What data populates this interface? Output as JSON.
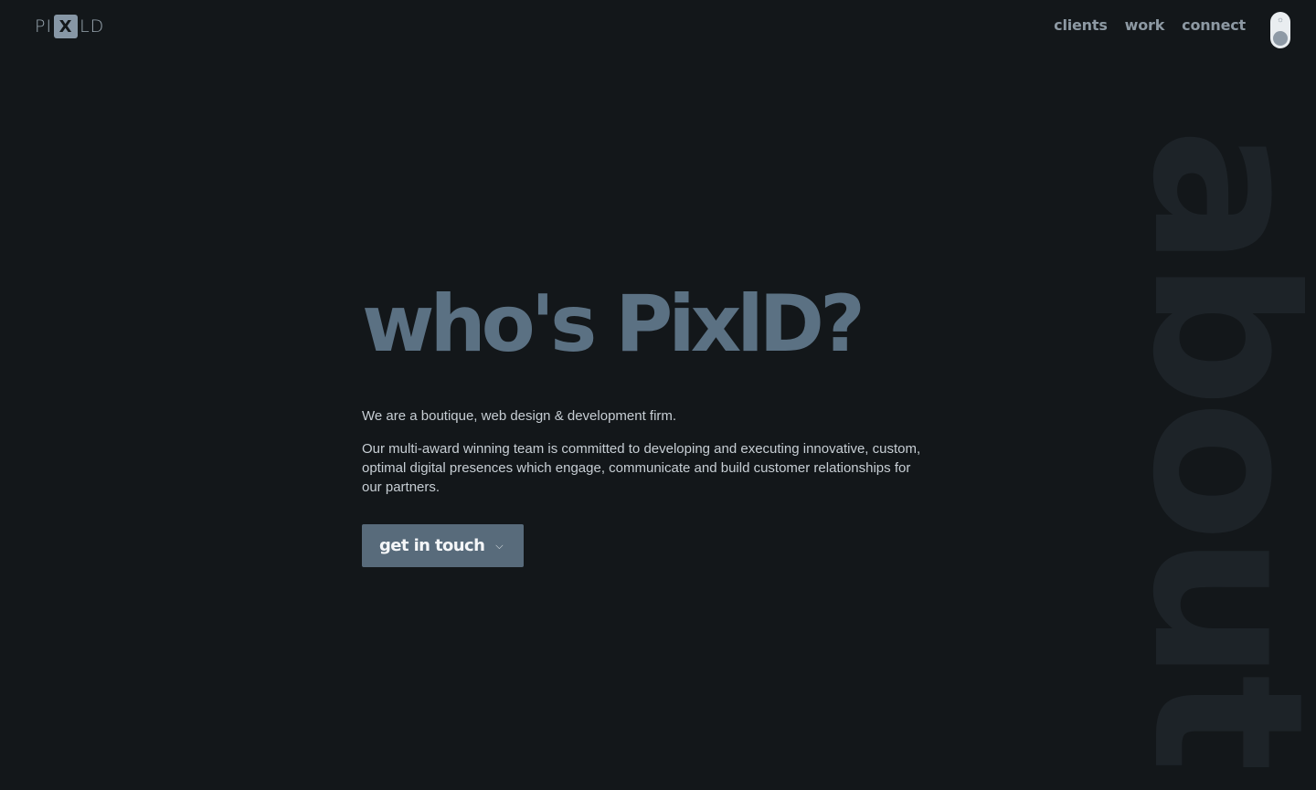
{
  "header": {
    "logo": {
      "left": "PI",
      "mark": "X",
      "right": "LD"
    },
    "nav": [
      {
        "label": "clients"
      },
      {
        "label": "work"
      },
      {
        "label": "connect"
      }
    ],
    "theme_toggle": {
      "icon": "sun-icon",
      "glyph": "☼",
      "state": "dark"
    }
  },
  "watermark": {
    "text": "about"
  },
  "hero": {
    "title": "who's PixlD?",
    "intro": "We are a boutique, web design & development firm.",
    "body": "Our multi-award winning team is committed to developing and executing innovative, custom, optimal digital presences which engage, communicate and build customer relationships for our partners.",
    "cta": {
      "label": "get in touch",
      "icon": "chevron-down-icon",
      "glyph": "⌵"
    }
  },
  "colors": {
    "background": "#13171a",
    "accent": "#586b7b",
    "title": "#5b7183",
    "text": "#c7ced4",
    "nav": "#8d99a3",
    "watermark": "#1d2328"
  }
}
